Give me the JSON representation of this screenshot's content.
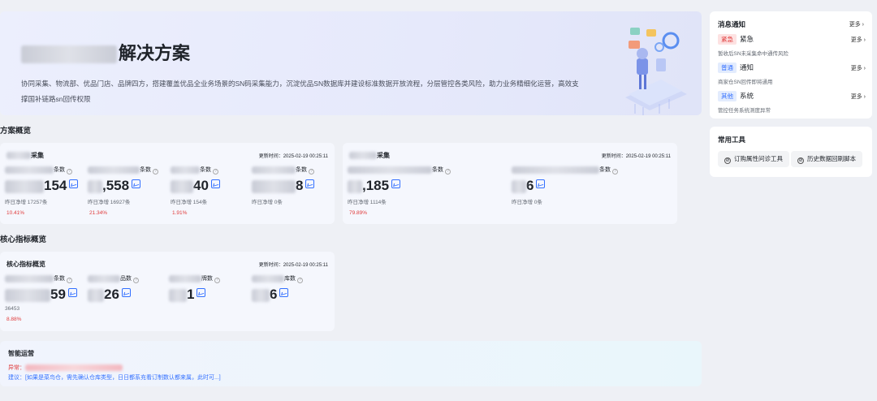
{
  "banner": {
    "title": "解决方案",
    "description": "协同采集、物流部、优品门店、品牌四方，搭建覆盖优品全业务场景的SN码采集能力，沉淀优品SN数据库并建设标准数据开放流程，分层管控各类风险，助力业务精细化运营，高效支撑国补链路sn回传权限"
  },
  "notice": {
    "title": "消息通知",
    "more": "更多",
    "items": [
      {
        "tag": "紧急",
        "title": "紧急",
        "sub": "暂收后SN未采集命中通传风险",
        "more": "更多"
      },
      {
        "tag": "普通",
        "title": "通知",
        "sub": "商家仓SN回传即将通用",
        "more": "更多"
      },
      {
        "tag": "其他",
        "title": "系统",
        "sub": "管控任务系统测度异常",
        "more": "更多"
      }
    ]
  },
  "tools": {
    "title": "常用工具",
    "buttons": [
      "订购属性问诊工具",
      "历史数据回刷脚本"
    ]
  },
  "overview": {
    "section_title": "方案概览",
    "card1": {
      "title": "采集",
      "update": "更新时间：2025-02-19 00:25:11",
      "metrics": [
        {
          "label": "条数",
          "value": "154",
          "sub": "昨日净增  17257条",
          "pct": "10.41%"
        },
        {
          "label": "条数",
          "value": ",558",
          "sub": "昨日净增  16927条",
          "pct": "21.34%"
        },
        {
          "label": "条数",
          "value": "40",
          "sub": "昨日净增  154条",
          "pct": "1.91%"
        },
        {
          "label": "条数",
          "value": "8",
          "sub": "昨日净增  0条",
          "pct": ""
        }
      ]
    },
    "card2": {
      "title": "采集",
      "update": "更新时间：2025-02-19 00:25:11",
      "metrics": [
        {
          "label": "条数",
          "value": ",185",
          "sub": "昨日净增  1114条",
          "pct": "79.89%"
        },
        {
          "label": "条数",
          "value": "6",
          "sub": "昨日净增  0条",
          "pct": ""
        }
      ]
    }
  },
  "core": {
    "section_title": "核心指标概览",
    "card": {
      "title": "核心指标概览",
      "update": "更新时间：2025-02-19 00:25:11",
      "metrics": [
        {
          "label": "条数",
          "value": "59",
          "sub": "36453",
          "pct": "8.88%"
        },
        {
          "label": "品数",
          "value": "26",
          "sub": "",
          "pct": ""
        },
        {
          "label": "牌数",
          "value": "1",
          "sub": "",
          "pct": ""
        },
        {
          "label": "库数",
          "value": "6",
          "sub": "",
          "pct": ""
        }
      ]
    }
  },
  "ops": {
    "title": "智能运营",
    "error_label": "异常：",
    "suggestion": "建议：[如果是菜鸟仓，需先确认仓库类型，日日都系充看订制数认都来属，此时可...]"
  }
}
